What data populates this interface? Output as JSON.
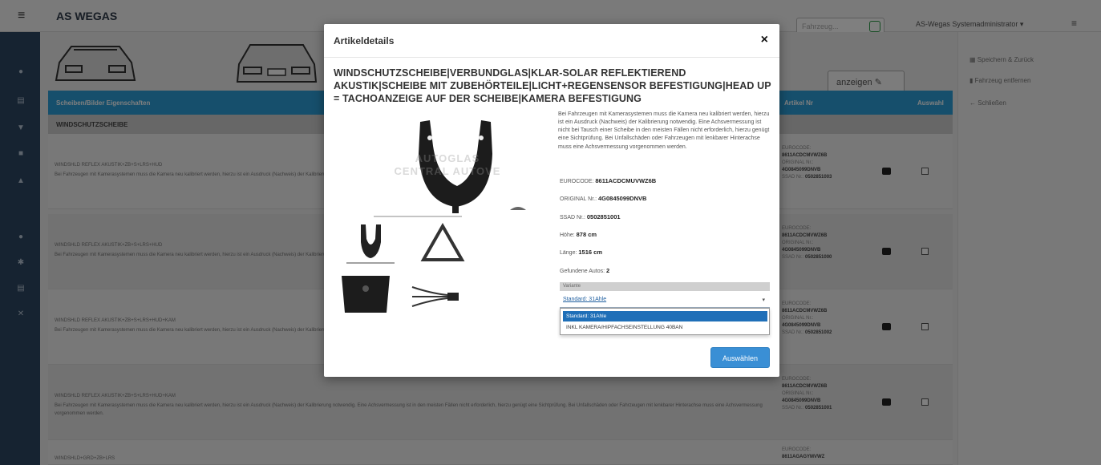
{
  "app": {
    "brand": "AS WEGAS",
    "search_placeholder": "Fahrzeug...",
    "user_menu": "AS-Wegas Systemadministrator ▾"
  },
  "page": {
    "show_button": "anzeigen",
    "table_headers": {
      "properties": "Scheiben/Bilder Eigenschaften",
      "article_no": "Artikel Nr",
      "select": "Auswahl"
    },
    "group_label": "WINDSCHUTZSCHEIBE",
    "rows": [
      {
        "code": "WINDSHLD REFLEX AKUSTIK+ZB+S+LRS+HUD",
        "desc": "Bei Fahrzeugen mit Kamerasystemen muss die Kamera neu kalibriert werden, hierzu ist ein Ausdruck (Nachweis) der Kalibrierung notwendig. Eine Achsvermessung ist in den meisten Fällen nicht erforderlich, hierzu genügt eine Sichtprüfung. Bei Unfallschäden",
        "eurocode": "8611ACDCMVWZ6B",
        "original": "4G0845099DNVB",
        "ssad": "0502851003"
      },
      {
        "code": "WINDSHLD REFLEX AKUSTIK+ZB+S+LRS+HUD",
        "desc": "Bei Fahrzeugen mit Kamerasystemen muss die Kamera neu kalibriert werden, hierzu ist ein Ausdruck (Nachweis) der Kalibrierung notwendig. Eine Achsvermessung ist in den meisten Fällen nicht erforderlich, hierzu genügt eine Sichtprüfung. Bei Unfallschäden",
        "eurocode": "8611ACDCMVWZ6B",
        "original": "4G0845099DNVB",
        "ssad": "0502851000"
      },
      {
        "code": "WINDSHLD REFLEX AKUSTIK+ZB+S+LRS+HUD+KAM",
        "desc": "Bei Fahrzeugen mit Kamerasystemen muss die Kamera neu kalibriert werden, hierzu ist ein Ausdruck (Nachweis) der Kalibrierung notwendig. Eine Achsvermessung ist in den meisten Fällen nicht erforderlich, hierzu genügt eine Sichtprüfung. Bei Unfallschäden",
        "eurocode": "8611ACDCMVWZ6B",
        "original": "4G0845099DNVB",
        "ssad": "0502851002"
      },
      {
        "code": "WINDSHLD REFLEX AKUSTIK+ZB+S+LRS+HUD+KAM",
        "desc": "Bei Fahrzeugen mit Kamerasystemen muss die Kamera neu kalibriert werden, hierzu ist ein Ausdruck (Nachweis) der Kalibrierung notwendig. Eine Achsvermessung ist in den meisten Fällen nicht erforderlich, hierzu genügt eine Sichtprüfung. Bei Unfallschäden oder Fahrzeugen mit lenkbarer Hinterachse muss eine Achsvermessung vorgenommen werden.",
        "eurocode": "8611ACDCMVWZ6B",
        "original": "4G0845099DNVB",
        "ssad": "0502851001"
      },
      {
        "code": "WINDSHLD+GRD+ZB+LRS",
        "desc": "",
        "eurocode": "8611AGAGYMVWZ",
        "original": "",
        "ssad": ""
      }
    ],
    "labels": {
      "eurocode": "EUROCODE:",
      "original": "ORIGINAL Nr.:",
      "ssad": "SSAD Nr.:"
    }
  },
  "right_panel": {
    "links": [
      "Speichern & Zurück",
      "Fahrzeug entfernen",
      "Schließen"
    ]
  },
  "modal": {
    "title": "Artikeldetails",
    "close": "×",
    "product_title": "WINDSCHUTZSCHEIBE|VERBUNDGLAS|KLAR-SOLAR REFLEKTIEREND AKUSTIK|SCHEIBE MIT ZUBEHÖRTEILE|LICHT+REGENSENSOR BEFESTIGUNG|HEAD UP = TACHOANZEIGE AUF DER SCHEIBE|KAMERA BEFESTIGUNG",
    "description": "Bei Fahrzeugen mit Kamerasystemen muss die Kamera neu kalibriert werden, hierzu ist ein Ausdruck (Nachweis) der Kalibrierung notwendig. Eine Achsvermessung ist nicht bei Tausch einer Scheibe in den meisten Fällen nicht erforderlich, hierzu genügt eine Sichtprüfung. Bei Unfallschäden oder Fahrzeugen mit lenkbarer Hinterachse muss eine Achsvermessung vorgenommen werden.",
    "eurocode_label": "EUROCODE:",
    "eurocode": "8611ACDCMUVWZ6B",
    "original_label": "ORIGINAL Nr.:",
    "original": "4G0845099DNVB",
    "ssad_label": "SSAD Nr.:",
    "ssad": "0502851001",
    "height_label": "Höhe:",
    "height": "878 cm",
    "length_label": "Länge:",
    "length": "1516 cm",
    "found_label": "Gefundene Autos:",
    "found": "2",
    "watermark": "AUTOGLAS CENTRAL AUTOVE",
    "select_label": "Variante",
    "select_value": "Standard: 31Ahle",
    "options": [
      "Standard: 31Ahle",
      "INKL KAMERA/HIPFACHSEINSTELLUNG 40BAN"
    ],
    "select_button": "Auswählen"
  }
}
